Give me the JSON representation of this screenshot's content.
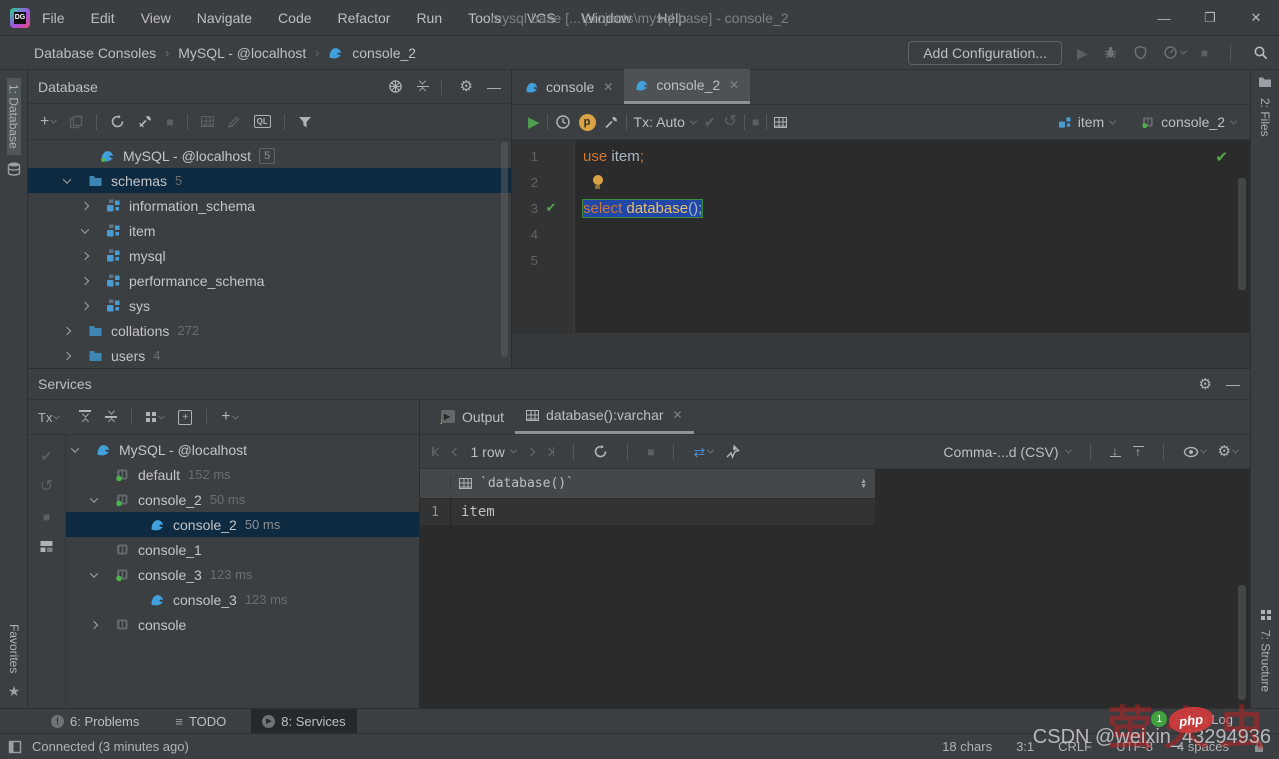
{
  "titlebar": {
    "title": "mysql base [...\\projects\\mysql base] - console_2",
    "menu": [
      "File",
      "Edit",
      "View",
      "Navigate",
      "Code",
      "Refactor",
      "Run",
      "Tools",
      "VCS",
      "Window",
      "Help"
    ],
    "window_controls": {
      "minimize": "—",
      "maximize": "❐",
      "close": "✕"
    }
  },
  "runbar": {
    "breadcrumb": [
      "Database Consoles",
      "MySQL - @localhost",
      "console_2"
    ],
    "add_configuration": "Add Configuration..."
  },
  "stripes": {
    "left_top": "1: Database",
    "left_bottom": "Favorites",
    "right_top": "2: Files",
    "right_bottom": "7: Structure"
  },
  "database": {
    "title": "Database",
    "tree": [
      {
        "label": "MySQL - @localhost",
        "badge": "5"
      },
      {
        "label": "schemas",
        "meta": "5"
      },
      {
        "label": "information_schema"
      },
      {
        "label": "item"
      },
      {
        "label": "mysql"
      },
      {
        "label": "performance_schema"
      },
      {
        "label": "sys"
      },
      {
        "label": "collations",
        "meta": "272"
      },
      {
        "label": "users",
        "meta": "4"
      }
    ]
  },
  "editor": {
    "tabs": [
      {
        "label": "console"
      },
      {
        "label": "console_2"
      }
    ],
    "toolbar": {
      "tx": "Tx: Auto",
      "schema": "item",
      "session": "console_2"
    },
    "line_numbers": [
      "1",
      "2",
      "3",
      "4",
      "5"
    ],
    "code": {
      "line1": {
        "kw": "use",
        "id": " item",
        "semi": ";"
      },
      "line3": {
        "kw": "select",
        "fn": " database",
        "rest": "();"
      }
    }
  },
  "services": {
    "title": "Services",
    "tx_label": "Tx",
    "tree": [
      {
        "label": "MySQL - @localhost"
      },
      {
        "label": "default",
        "meta": "152 ms"
      },
      {
        "label": "console_2",
        "meta": "50 ms"
      },
      {
        "label": "console_2",
        "meta": "50 ms"
      },
      {
        "label": "console_1"
      },
      {
        "label": "console_3",
        "meta": "123 ms"
      },
      {
        "label": "console_3",
        "meta": "123 ms"
      },
      {
        "label": "console"
      }
    ]
  },
  "output": {
    "tabs": [
      {
        "label": "Output"
      },
      {
        "label": "database():varchar"
      }
    ],
    "pager": "1 row",
    "format": "Comma-...d (CSV)",
    "grid": {
      "column": "`database()`",
      "rows": [
        {
          "n": "1",
          "value": "item"
        }
      ]
    }
  },
  "bottom_bar": {
    "problems": "6: Problems",
    "todo": "TODO",
    "services": "8: Services"
  },
  "event_log": {
    "count": "1",
    "label": "Event Log"
  },
  "status_bar": {
    "connected": "Connected (3 minutes ago)",
    "chars": "18 chars",
    "caret": "3:1",
    "line_sep": "CRLF",
    "encoding": "UTF-8",
    "indent": "4 spaces"
  },
  "watermark": {
    "csdn": "CSDN @weixin_43294936",
    "php": "php",
    "cn": "萤火虫"
  },
  "colors": {
    "accent_blue": "#41a0dc",
    "selection_row": "#0d2a41",
    "exec_selection": "#2147a8",
    "keyword": "#cc7832",
    "function": "#e8bf6a",
    "success_green": "#57a64a",
    "bulb_orange": "#d9a343",
    "watermark_red": "#c41e1e"
  }
}
